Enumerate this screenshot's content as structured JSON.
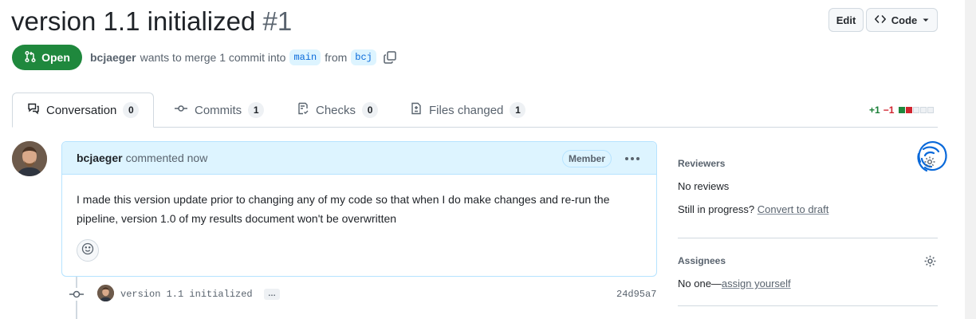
{
  "header": {
    "title": "version 1.1 initialized",
    "number": "#1",
    "edit_label": "Edit",
    "code_label": "Code"
  },
  "state": {
    "label": "Open",
    "color": "#1f883d",
    "author": "bcjaeger",
    "merge_text": "wants to merge 1 commit into",
    "base_branch": "main",
    "from_text": "from",
    "head_branch": "bcj"
  },
  "tabs": [
    {
      "label": "Conversation",
      "count": "0",
      "icon": "comment-discussion-icon",
      "active": true
    },
    {
      "label": "Commits",
      "count": "1",
      "icon": "git-commit-icon"
    },
    {
      "label": "Checks",
      "count": "0",
      "icon": "checklist-icon"
    },
    {
      "label": "Files changed",
      "count": "1",
      "icon": "file-diff-icon"
    }
  ],
  "diffstat": {
    "additions": "+1",
    "deletions": "−1",
    "blocks": [
      "green",
      "red",
      "gray",
      "gray",
      "gray"
    ]
  },
  "comment": {
    "author": "bcjaeger",
    "action": "commented now",
    "role_badge": "Member",
    "body": "I made this version update prior to changing any of my code so that when I do make changes and re-run the pipeline, version 1.0 of my results document won't be overwritten"
  },
  "commit": {
    "message": "version 1.1 initialized",
    "expand_label": "…",
    "sha": "24d95a7"
  },
  "sidebar": {
    "reviewers": {
      "title": "Reviewers",
      "value": "No reviews",
      "progress_text": "Still in progress?",
      "convert_link": "Convert to draft"
    },
    "assignees": {
      "title": "Assignees",
      "value_prefix": "No one—",
      "assign_link": "assign yourself"
    }
  },
  "colors": {
    "accent": "#0969da",
    "success": "#1f883d",
    "danger": "#d1242f",
    "comment_header": "#ddf4ff"
  }
}
